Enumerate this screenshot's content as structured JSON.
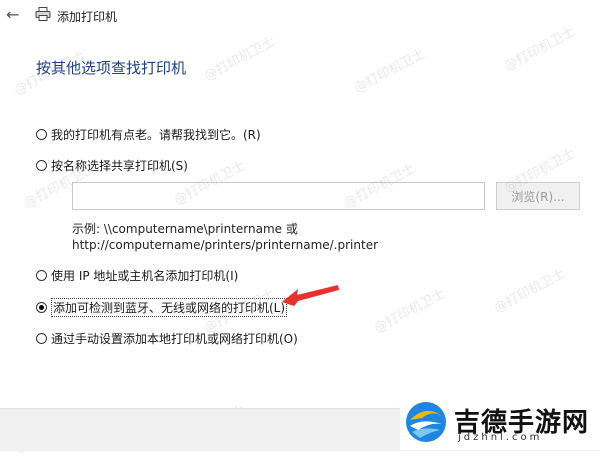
{
  "window": {
    "back_icon": "back-arrow-icon",
    "printer_icon": "printer-icon",
    "title": "添加打印机"
  },
  "heading": "按其他选项查找打印机",
  "options": [
    {
      "label": "我的打印机有点老。请帮我找到它。(R)",
      "selected": false
    },
    {
      "label": "按名称选择共享打印机(S)",
      "selected": false
    },
    {
      "label": "使用 IP 地址或主机名添加打印机(I)",
      "selected": false
    },
    {
      "label": "添加可检测到蓝牙、无线或网络的打印机(L)",
      "selected": true
    },
    {
      "label": "通过手动设置添加本地打印机或网络打印机(O)",
      "selected": false
    }
  ],
  "share_printer": {
    "value": "",
    "browse_label": "浏览(R)...",
    "example_line1": "示例: \\\\computername\\printername 或",
    "example_line2": "http://computername/printers/printername/.printer"
  },
  "annotation": {
    "arrow_color": "#e8312f",
    "points_to": "添加可检测到蓝牙、无线或网络的打印机(L)"
  },
  "watermark_text": "@打印机卫士",
  "brand_logo": {
    "name_cn": "吉德手游网",
    "name_en": "jdzhnl.com"
  }
}
